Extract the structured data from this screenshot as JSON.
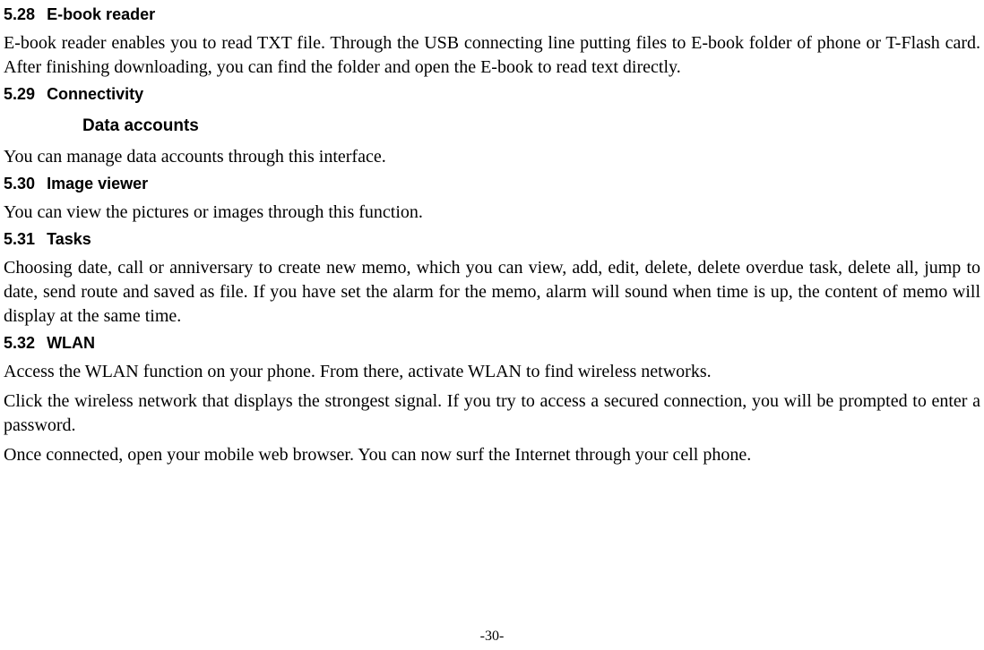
{
  "sections": {
    "s528": {
      "num": "5.28",
      "title": "E-book reader",
      "body": "E-book reader enables you to read TXT file. Through the USB connecting line putting files to E-book folder of phone or T-Flash card. After finishing downloading, you can find the folder and open the E-book to read text directly."
    },
    "s529": {
      "num": "5.29",
      "title": "Connectivity",
      "sub": "Data accounts",
      "body": "You can manage data accounts through this interface."
    },
    "s530": {
      "num": "5.30",
      "title": "Image viewer",
      "body": "You can view the pictures or images through this function."
    },
    "s531": {
      "num": "5.31",
      "title": "Tasks",
      "body": "Choosing date, call or anniversary to create new memo, which you can view, add, edit, delete, delete overdue task, delete all, jump to date, send route and saved as file. If you have set the alarm for the memo, alarm will sound when time is up, the content of memo will display at the same time."
    },
    "s532": {
      "num": "5.32",
      "title": "WLAN",
      "p1": "Access the WLAN function on your phone. From there, activate WLAN to find wireless networks.",
      "p2": "Click the wireless network that displays the strongest signal. If you try to access a secured connection, you will be prompted to enter a password.",
      "p3": "Once connected, open your mobile web browser. You can now surf the Internet through your cell phone."
    }
  },
  "footer": {
    "page": "-30-"
  }
}
